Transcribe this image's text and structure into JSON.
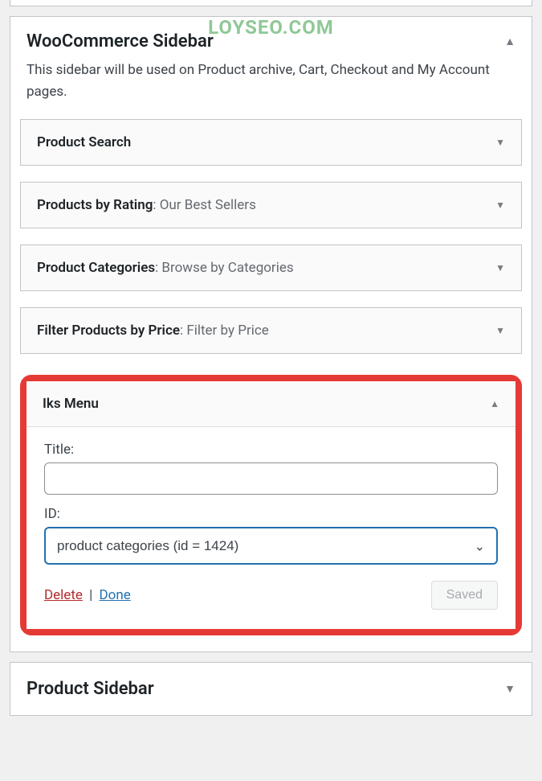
{
  "watermark": "LOYSEO.COM",
  "woocommerce_sidebar": {
    "title": "WooCommerce Sidebar",
    "description": "This sidebar will be used on Product archive, Cart, Checkout and My Account pages.",
    "widgets": [
      {
        "name": "Product Search"
      },
      {
        "name": "Products by Rating",
        "subtitle_display": ": Our Best Sellers"
      },
      {
        "name": "Product Categories",
        "subtitle_display": ": Browse by Categories"
      },
      {
        "name": "Filter Products by Price",
        "subtitle_display": ": Filter by Price"
      }
    ],
    "iks_menu": {
      "name": "Iks Menu",
      "title_label": "Title:",
      "title_value": "",
      "id_label": "ID:",
      "id_selected": "product categories (id = 1424)",
      "delete_label": "Delete",
      "separator": "|",
      "done_label": "Done",
      "saved_label": "Saved"
    }
  },
  "product_sidebar": {
    "title": "Product Sidebar"
  }
}
